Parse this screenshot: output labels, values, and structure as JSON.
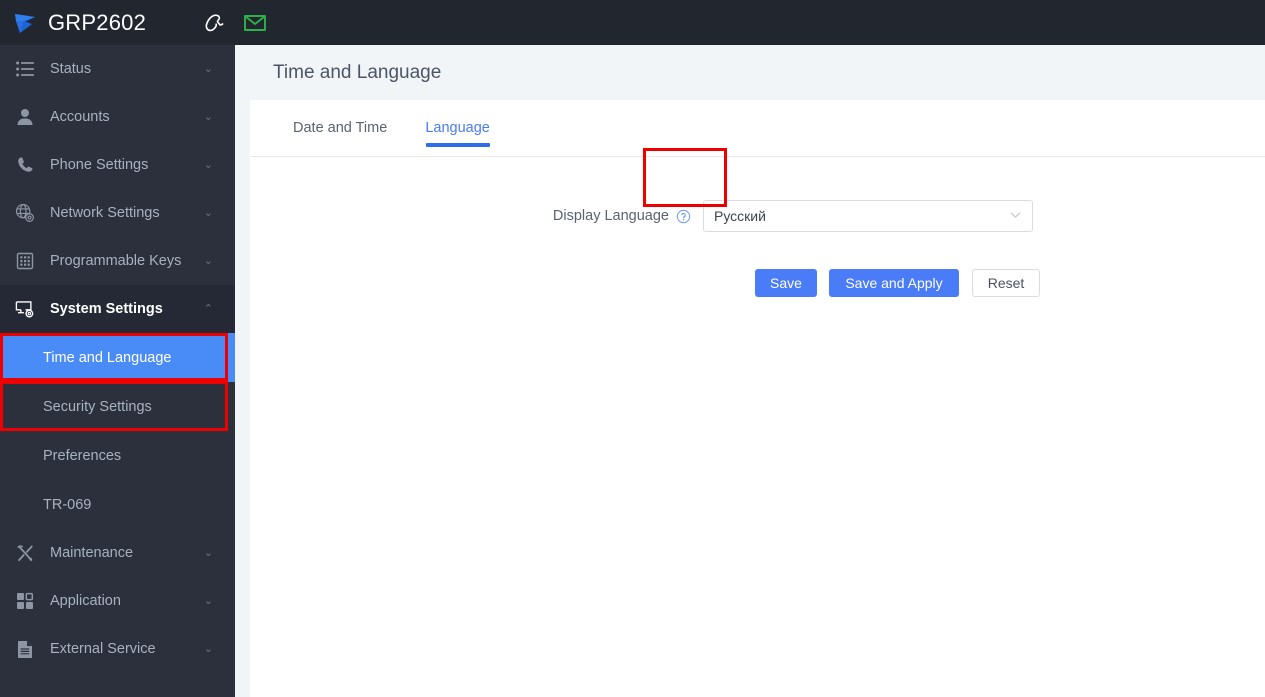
{
  "header": {
    "logo_icon": "grandstream-logo-icon",
    "title": "GRP2602",
    "phone_icon": "phone-icon",
    "mail_icon": "mail-icon",
    "background_color": "#21262f"
  },
  "sidebar": {
    "background_color": "#2b303c",
    "active_color": "#4a8cf7",
    "items": [
      {
        "label": "Status",
        "icon": "list-icon",
        "chevron": "⌄",
        "expanded": false
      },
      {
        "label": "Accounts",
        "icon": "user-icon",
        "chevron": "⌄",
        "expanded": false
      },
      {
        "label": "Phone Settings",
        "icon": "phone-handset-icon",
        "chevron": "⌄",
        "expanded": false
      },
      {
        "label": "Network Settings",
        "icon": "globe-gear-icon",
        "chevron": "⌄",
        "expanded": false
      },
      {
        "label": "Programmable Keys",
        "icon": "keypad-grid-icon",
        "chevron": "⌄",
        "expanded": false
      },
      {
        "label": "System Settings",
        "icon": "monitor-gear-icon",
        "chevron": "⌃",
        "expanded": true
      },
      {
        "label": "Maintenance",
        "icon": "tools-icon",
        "chevron": "⌄",
        "expanded": false
      },
      {
        "label": "Application",
        "icon": "apps-grid-icon",
        "chevron": "⌄",
        "expanded": false
      },
      {
        "label": "External Service",
        "icon": "document-icon",
        "chevron": "⌄",
        "expanded": false
      }
    ],
    "sub_items": [
      {
        "label": "Time and Language",
        "active": true
      },
      {
        "label": "Security Settings",
        "active": false
      },
      {
        "label": "Preferences",
        "active": false
      },
      {
        "label": "TR-069",
        "active": false
      }
    ]
  },
  "main": {
    "page_title": "Time and Language",
    "tabs": [
      {
        "label": "Date and Time",
        "active": false
      },
      {
        "label": "Language",
        "active": true
      }
    ],
    "form": {
      "field_label": "Display Language",
      "help_icon": "help-circle-icon",
      "select_value": "Русский",
      "select_chevron_icon": "chevron-down-icon"
    },
    "buttons": {
      "save": "Save",
      "save_and_apply": "Save and Apply",
      "reset": "Reset",
      "primary_color": "#4a7cf7"
    }
  },
  "annotations": {
    "color": "#ee0000",
    "boxes": [
      {
        "name": "system-settings-highlight"
      },
      {
        "name": "time-and-language-highlight"
      },
      {
        "name": "language-tab-highlight"
      }
    ]
  }
}
